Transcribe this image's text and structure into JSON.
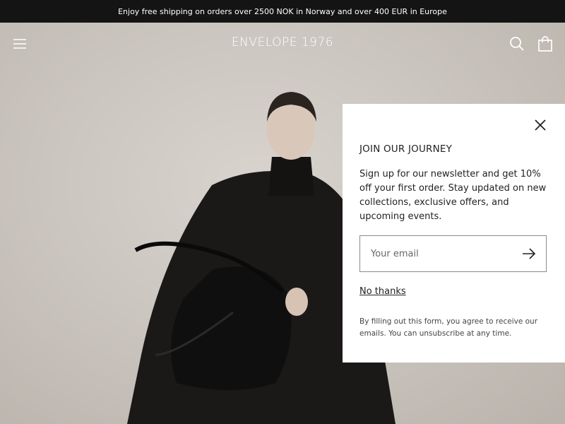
{
  "announcement": {
    "text": "Enjoy free shipping on orders over 2500 NOK in Norway and over 400 EUR in Europe"
  },
  "header": {
    "logo": "ENVELOPE 1976",
    "icons": {
      "menu": "hamburger-menu-icon",
      "search": "search-icon",
      "cart": "shopping-bag-icon"
    }
  },
  "popup": {
    "title": "JOIN OUR JOURNEY",
    "body": "Sign up for our newsletter and get 10% off your first order. Stay updated on new collections, exclusive offers, and upcoming events.",
    "email_placeholder": "Your email",
    "submit_icon": "arrow-right-icon",
    "close_icon": "close-icon",
    "dismiss_label": "No thanks",
    "legal": "By filling out this form, you agree to receive our emails. You can unsubscribe at any time."
  },
  "colors": {
    "announcement_bg": "#141414",
    "popup_bg": "#ffffff",
    "text": "#222222"
  }
}
